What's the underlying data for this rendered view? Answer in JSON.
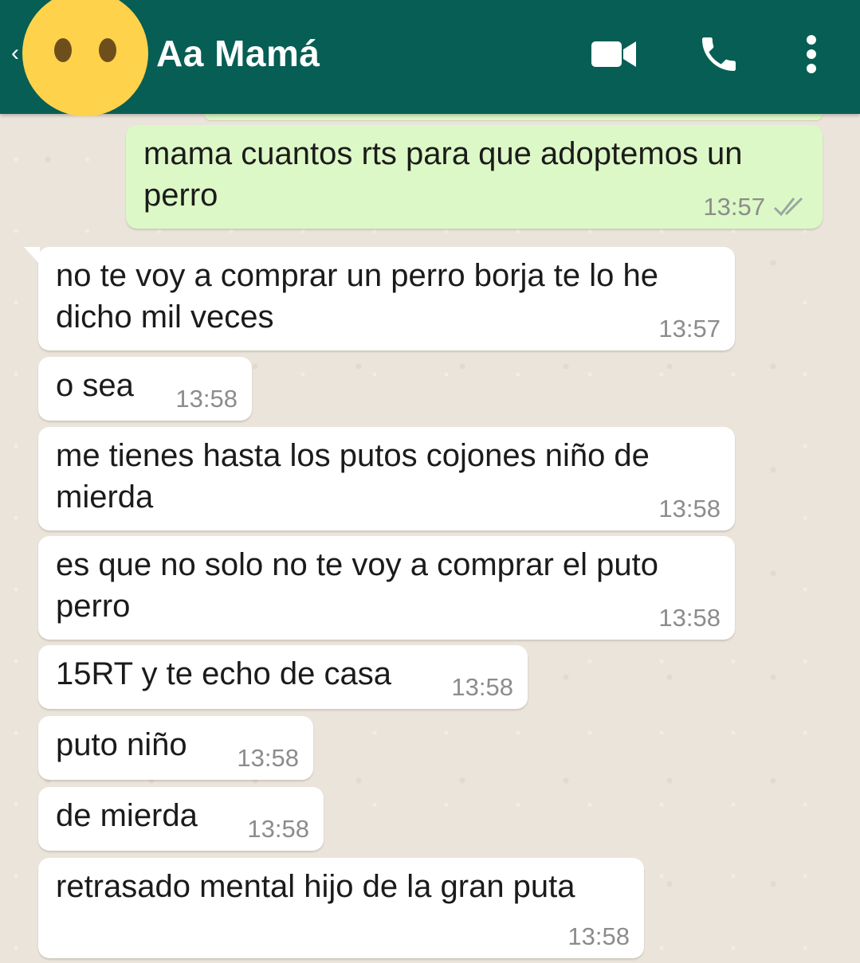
{
  "header": {
    "contact_name": "Aa Mamá",
    "back_icon": "back-arrow-icon",
    "video_icon": "video-call-icon",
    "call_icon": "phone-icon",
    "menu_icon": "more-options-icon",
    "bar_color": "#075e54",
    "avatar_color": "#ffd24c"
  },
  "messages": [
    {
      "direction": "out",
      "text": "mama cuantos rts para que adoptemos un perro",
      "time": "13:57",
      "status": "read-ticks"
    },
    {
      "direction": "in",
      "text": "no te voy a comprar un perro borja te lo he dicho mil veces",
      "time": "13:57"
    },
    {
      "direction": "in",
      "text": "o sea",
      "time": "13:58"
    },
    {
      "direction": "in",
      "text": "me tienes hasta los putos cojones niño de mierda",
      "time": "13:58"
    },
    {
      "direction": "in",
      "text": "es que no solo no te voy a comprar el puto perro",
      "time": "13:58"
    },
    {
      "direction": "in",
      "text": "15RT y te echo de casa",
      "time": "13:58"
    },
    {
      "direction": "in",
      "text": "puto niño",
      "time": "13:58"
    },
    {
      "direction": "in",
      "text": "de mierda",
      "time": "13:58"
    },
    {
      "direction": "in",
      "text": "retrasado mental hijo de la gran puta",
      "time": "13:58"
    }
  ],
  "colors": {
    "outgoing_bubble": "#dcf8c6",
    "incoming_bubble": "#ffffff",
    "chat_background": "#ebe4da",
    "read_ticks": "#9aa7a0"
  }
}
